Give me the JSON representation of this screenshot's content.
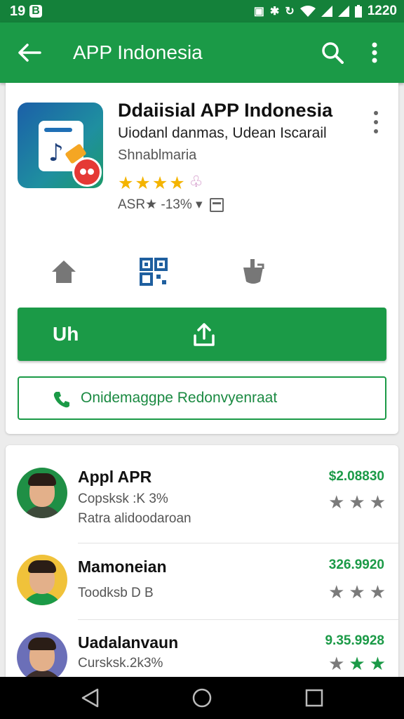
{
  "status_bar": {
    "left_text": "19",
    "left_badge": "B",
    "time": "1220",
    "icons": [
      "nfc-icon",
      "bluetooth-icon",
      "sync-icon",
      "wifi-icon",
      "signal-icon",
      "signal-icon",
      "battery-icon"
    ]
  },
  "app_bar": {
    "title": "APP Indonesia",
    "color": "#1b9a47"
  },
  "app": {
    "title": "Ddaiisial APP Indonesia",
    "subtitle": "Uiodanl danmas, Udean Iscarail",
    "developer": "Shnablmaria",
    "rating_stars": 4,
    "meta_text": "ASR★ -13% ▾"
  },
  "actions": {
    "install_label": "Uh",
    "contact_label": "Onidemaggpe Redonvyenraat"
  },
  "list": [
    {
      "name": "Appl APR",
      "line1": "Copsksk :K 3%",
      "line2": "Ratra alidoodaroan",
      "price": "$2.08830",
      "stars_gray": 3,
      "stars_green": 0
    },
    {
      "name": "Mamoneian",
      "line1": "Toodksb D B",
      "line2": "",
      "price": "326.9920",
      "stars_gray": 3,
      "stars_green": 0
    },
    {
      "name": "Uadalanvaun",
      "line1": "Cursksk.2k3%",
      "line2": "",
      "price": "9.35.9928",
      "stars_gray": 1,
      "stars_green": 2
    }
  ]
}
